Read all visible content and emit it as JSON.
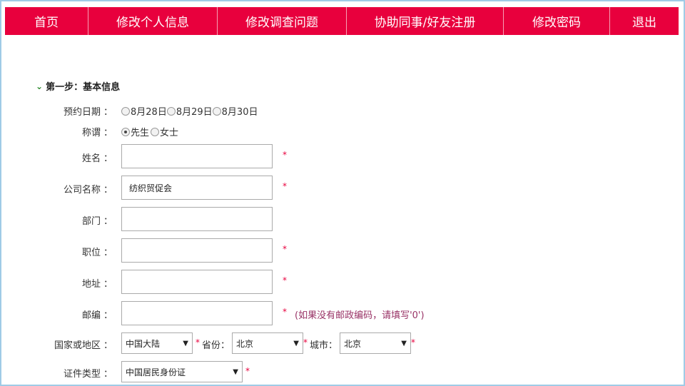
{
  "nav": [
    {
      "label": "首页",
      "w": 117
    },
    {
      "label": "修改个人信息",
      "w": 181
    },
    {
      "label": "修改调查问题",
      "w": 181
    },
    {
      "label": "协助同事/好友注册",
      "w": 220
    },
    {
      "label": "修改密码",
      "w": 149
    },
    {
      "label": "退出",
      "w": 96
    }
  ],
  "section": {
    "title": "第一步：基本信息"
  },
  "form": {
    "date": {
      "label": "预约日期",
      "options": [
        "8月28日",
        "8月29日",
        "8月30日"
      ]
    },
    "title": {
      "label": "称谓",
      "options": [
        "先生",
        "女士"
      ]
    },
    "name": {
      "label": "姓名",
      "value": ""
    },
    "company": {
      "label": "公司名称",
      "value": "纺织贸促会"
    },
    "dept": {
      "label": "部门",
      "value": ""
    },
    "position": {
      "label": "职位",
      "value": ""
    },
    "address": {
      "label": "地址",
      "value": ""
    },
    "postcode": {
      "label": "邮编",
      "value": "",
      "hint": "(如果没有邮政编码，请填写'0')"
    },
    "region": {
      "label": "国家或地区",
      "value": "中国大陆"
    },
    "province": {
      "label": "省份",
      "value": "北京"
    },
    "city": {
      "label": "城市",
      "value": "北京"
    },
    "idtype": {
      "label": "证件类型",
      "value": "中国居民身份证"
    },
    "required_mark": "*",
    "colon": "："
  }
}
